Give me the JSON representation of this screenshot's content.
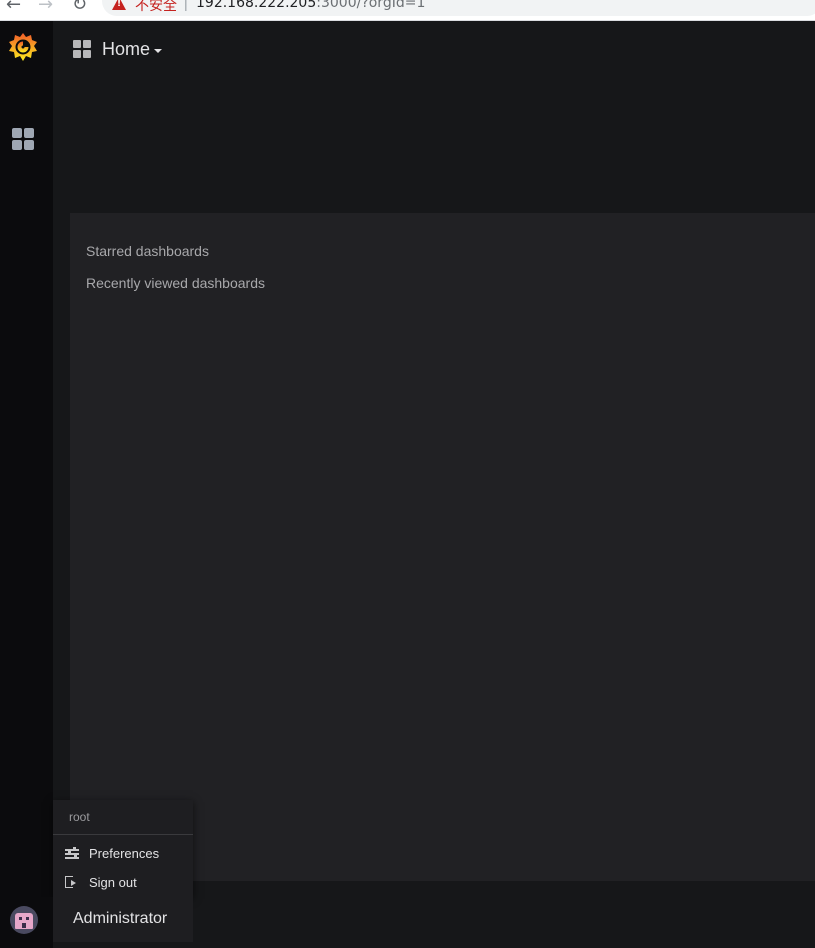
{
  "browser": {
    "insecure_label": "不安全",
    "separator": "|",
    "url_host": "192.168.222.205",
    "url_rest": ":3000/?orgId=1"
  },
  "navbar": {
    "title": "Home"
  },
  "home": {
    "starred_label": "Starred dashboards",
    "recent_label": "Recently viewed dashboards"
  },
  "profile_menu": {
    "username": "root",
    "items": [
      {
        "label": "Preferences",
        "icon": "sliders-icon"
      },
      {
        "label": "Sign out",
        "icon": "sign-out-icon"
      }
    ],
    "role_label": "Administrator"
  },
  "colors": {
    "background": "#161719",
    "sidebar": "#0b0b0d",
    "panel": "#212124",
    "text_primary": "#e3e3e5",
    "text_secondary": "#a8a8ab",
    "insecure": "#c5221f"
  }
}
